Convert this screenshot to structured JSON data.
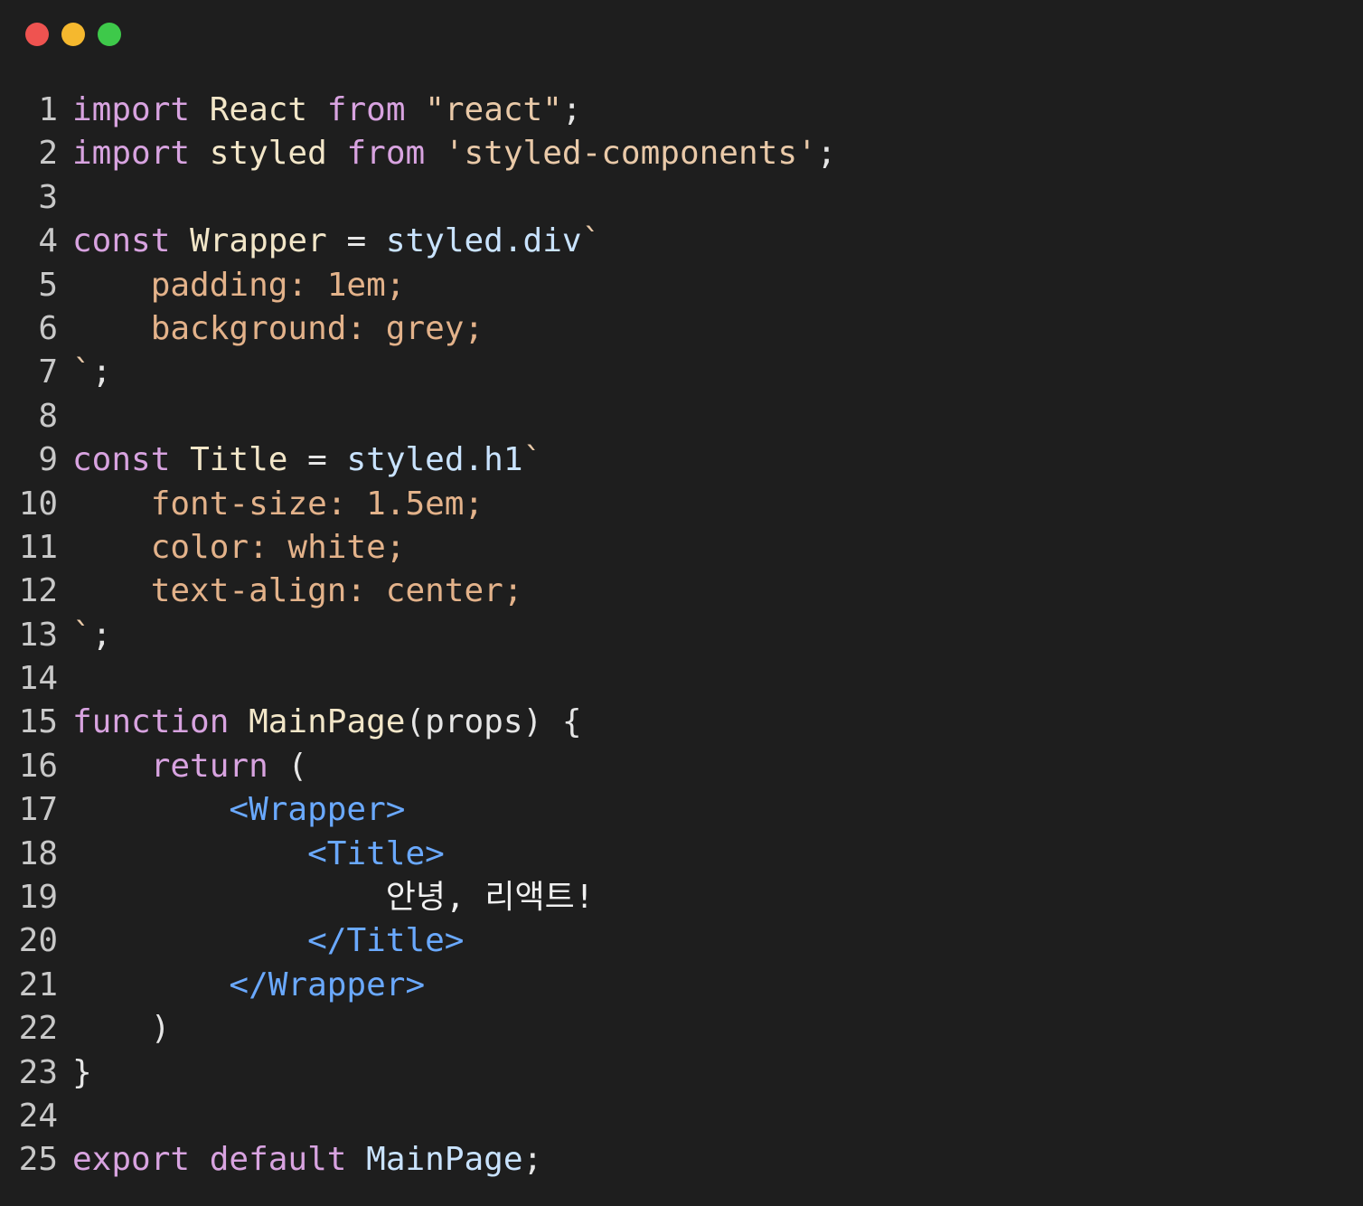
{
  "window": {
    "controls": [
      {
        "name": "close-button",
        "color": "#ef5350"
      },
      {
        "name": "minimize-button",
        "color": "#f5b82e"
      },
      {
        "name": "maximize-button",
        "color": "#3ec94a"
      }
    ]
  },
  "editor": {
    "lines": [
      {
        "num": "1",
        "tokens": [
          {
            "t": "import",
            "c": "kw"
          },
          {
            "t": " "
          },
          {
            "t": "React",
            "c": "id"
          },
          {
            "t": " "
          },
          {
            "t": "from",
            "c": "kw"
          },
          {
            "t": " "
          },
          {
            "t": "\"react\"",
            "c": "str"
          },
          {
            "t": ";",
            "c": "plain"
          }
        ]
      },
      {
        "num": "2",
        "tokens": [
          {
            "t": "import",
            "c": "kw"
          },
          {
            "t": " "
          },
          {
            "t": "styled",
            "c": "id"
          },
          {
            "t": " "
          },
          {
            "t": "from",
            "c": "kw"
          },
          {
            "t": " "
          },
          {
            "t": "'styled-components'",
            "c": "str"
          },
          {
            "t": ";",
            "c": "plain"
          }
        ]
      },
      {
        "num": "3",
        "tokens": []
      },
      {
        "num": "4",
        "tokens": [
          {
            "t": "const",
            "c": "kw"
          },
          {
            "t": " "
          },
          {
            "t": "Wrapper",
            "c": "id"
          },
          {
            "t": " = ",
            "c": "plain"
          },
          {
            "t": "styled.div",
            "c": "obj"
          },
          {
            "t": "`",
            "c": "str"
          }
        ]
      },
      {
        "num": "5",
        "tokens": [
          {
            "t": "    padding: 1em;",
            "c": "css"
          }
        ]
      },
      {
        "num": "6",
        "tokens": [
          {
            "t": "    background: grey;",
            "c": "css"
          }
        ]
      },
      {
        "num": "7",
        "tokens": [
          {
            "t": "`",
            "c": "str"
          },
          {
            "t": ";",
            "c": "plain"
          }
        ]
      },
      {
        "num": "8",
        "tokens": []
      },
      {
        "num": "9",
        "tokens": [
          {
            "t": "const",
            "c": "kw"
          },
          {
            "t": " "
          },
          {
            "t": "Title",
            "c": "id"
          },
          {
            "t": " = ",
            "c": "plain"
          },
          {
            "t": "styled.h1",
            "c": "obj"
          },
          {
            "t": "`",
            "c": "str"
          }
        ]
      },
      {
        "num": "10",
        "tokens": [
          {
            "t": "    font-size: 1.5em;",
            "c": "css"
          }
        ]
      },
      {
        "num": "11",
        "tokens": [
          {
            "t": "    color: white;",
            "c": "css"
          }
        ]
      },
      {
        "num": "12",
        "tokens": [
          {
            "t": "    text-align: center;",
            "c": "css"
          }
        ]
      },
      {
        "num": "13",
        "tokens": [
          {
            "t": "`",
            "c": "str"
          },
          {
            "t": ";",
            "c": "plain"
          }
        ]
      },
      {
        "num": "14",
        "tokens": []
      },
      {
        "num": "15",
        "tokens": [
          {
            "t": "function",
            "c": "kw"
          },
          {
            "t": " "
          },
          {
            "t": "MainPage",
            "c": "fn"
          },
          {
            "t": "(props) {",
            "c": "plain"
          }
        ]
      },
      {
        "num": "16",
        "tokens": [
          {
            "t": "    "
          },
          {
            "t": "return",
            "c": "kw"
          },
          {
            "t": " (",
            "c": "plain"
          }
        ]
      },
      {
        "num": "17",
        "tokens": [
          {
            "t": "        "
          },
          {
            "t": "<Wrapper>",
            "c": "tag"
          }
        ]
      },
      {
        "num": "18",
        "tokens": [
          {
            "t": "            "
          },
          {
            "t": "<Title>",
            "c": "tag"
          }
        ]
      },
      {
        "num": "19",
        "tokens": [
          {
            "t": "                "
          },
          {
            "t": "안녕, 리액트!",
            "c": "ko"
          }
        ]
      },
      {
        "num": "20",
        "tokens": [
          {
            "t": "            "
          },
          {
            "t": "</Title>",
            "c": "tag"
          }
        ]
      },
      {
        "num": "21",
        "tokens": [
          {
            "t": "        "
          },
          {
            "t": "</Wrapper>",
            "c": "tag"
          }
        ]
      },
      {
        "num": "22",
        "tokens": [
          {
            "t": "    )",
            "c": "plain"
          }
        ]
      },
      {
        "num": "23",
        "tokens": [
          {
            "t": "}",
            "c": "plain"
          }
        ]
      },
      {
        "num": "24",
        "tokens": []
      },
      {
        "num": "25",
        "tokens": [
          {
            "t": "export",
            "c": "kw"
          },
          {
            "t": " "
          },
          {
            "t": "default",
            "c": "kw"
          },
          {
            "t": " "
          },
          {
            "t": "MainPage",
            "c": "obj"
          },
          {
            "t": ";",
            "c": "plain"
          }
        ]
      }
    ]
  }
}
